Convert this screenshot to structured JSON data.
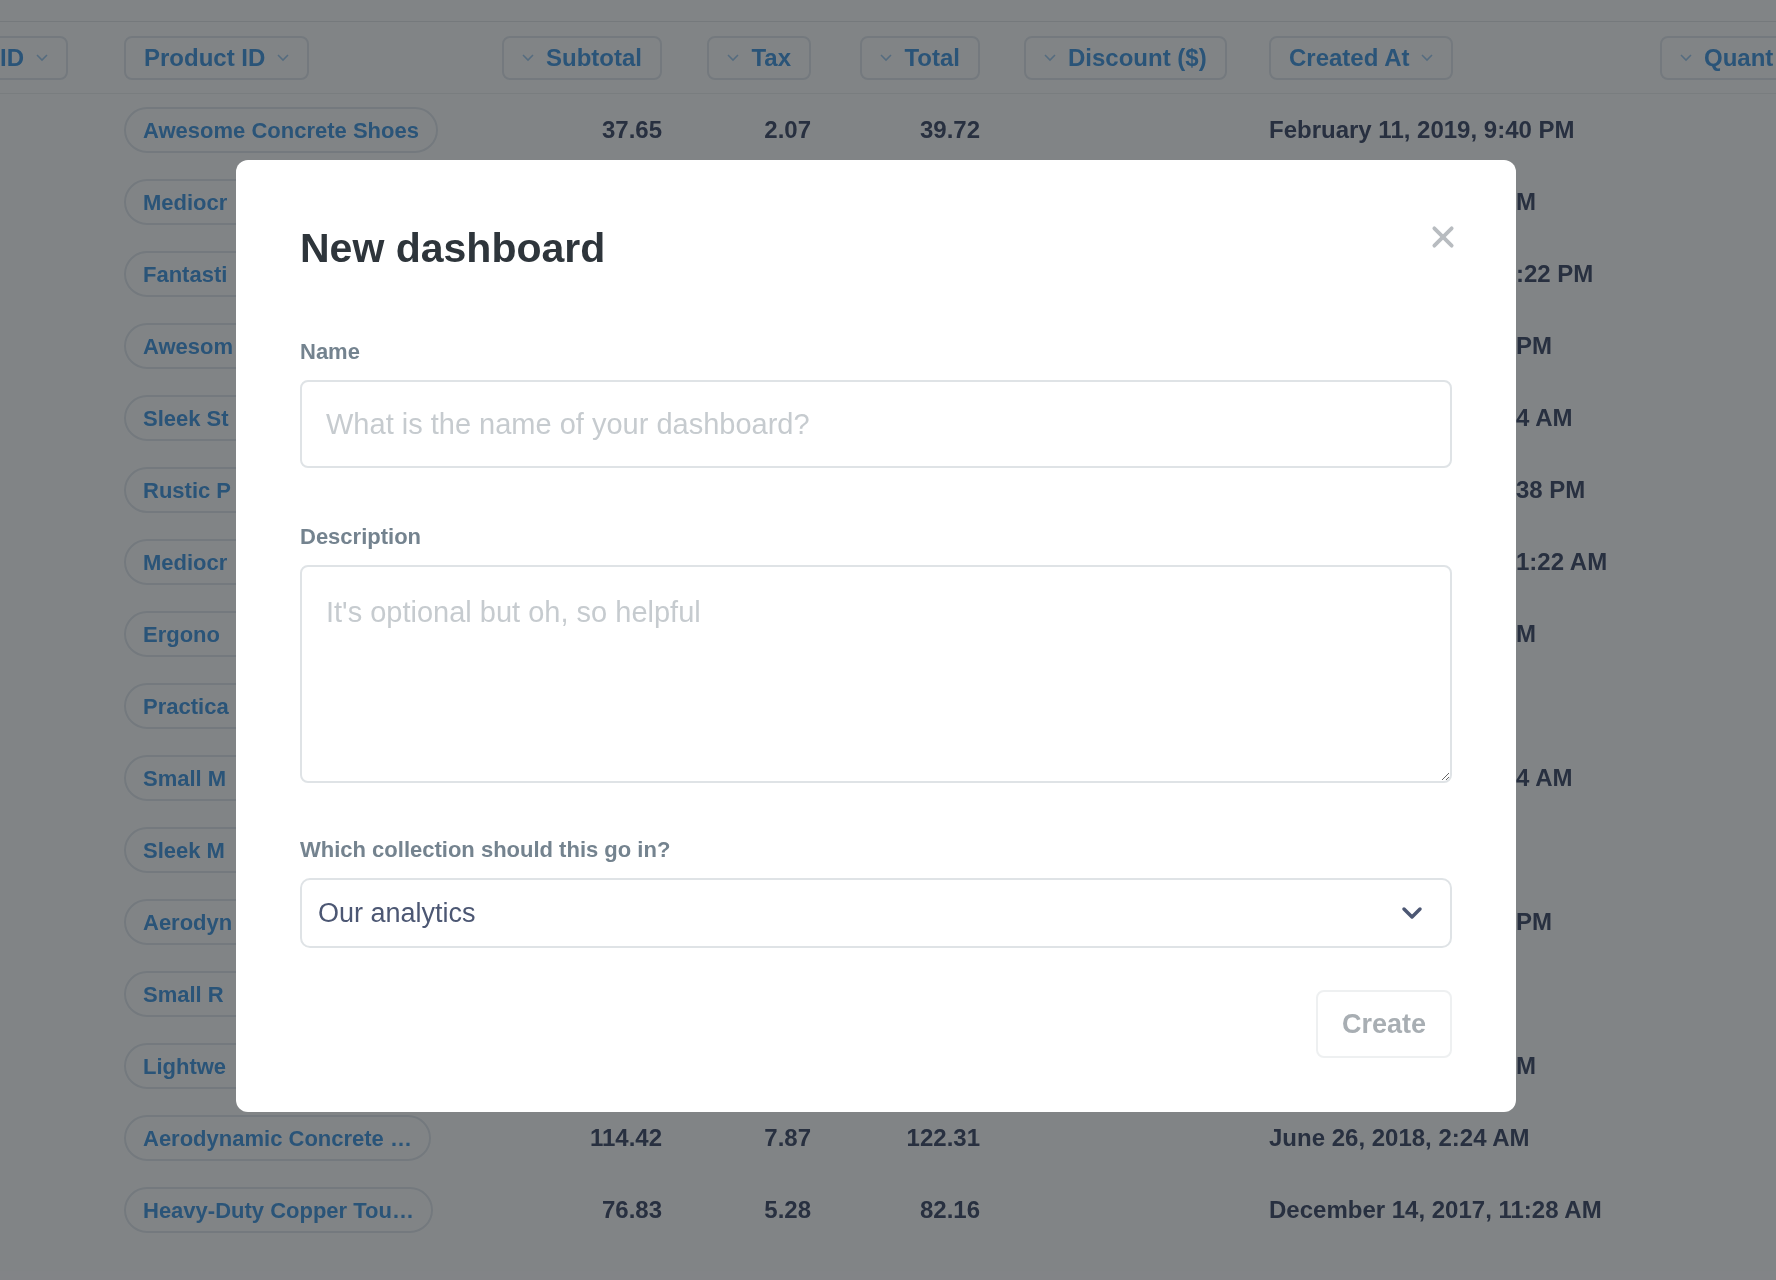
{
  "table": {
    "columns": [
      {
        "label": "ID",
        "kind": "text"
      },
      {
        "label": "Product ID",
        "kind": "text"
      },
      {
        "label": "Subtotal",
        "kind": "number"
      },
      {
        "label": "Tax",
        "kind": "number"
      },
      {
        "label": "Total",
        "kind": "number"
      },
      {
        "label": "Discount ($)",
        "kind": "number"
      },
      {
        "label": "Created At",
        "kind": "text"
      },
      {
        "label": "Quant",
        "kind": "number"
      }
    ],
    "rows": [
      {
        "covered": false,
        "product": "Awesome Concrete Shoes",
        "subtotal": "37.65",
        "tax": "2.07",
        "total": "39.72",
        "created_at": "February 11, 2019, 9:40 PM"
      },
      {
        "covered": true,
        "product": "Mediocr",
        "created_at": "M"
      },
      {
        "covered": true,
        "product": "Fantasti",
        "created_at": ":22 PM"
      },
      {
        "covered": true,
        "product": "Awesom",
        "created_at": "PM"
      },
      {
        "covered": true,
        "product": "Sleek St",
        "created_at": "4 AM"
      },
      {
        "covered": true,
        "product": "Rustic P",
        "created_at": "38 PM"
      },
      {
        "covered": true,
        "product": "Mediocr",
        "created_at": "1:22 AM"
      },
      {
        "covered": true,
        "product": "Ergono",
        "created_at": "M"
      },
      {
        "covered": true,
        "product": "Practica"
      },
      {
        "covered": true,
        "product": "Small M",
        "created_at": "4 AM"
      },
      {
        "covered": true,
        "product": "Sleek M"
      },
      {
        "covered": true,
        "product": "Aerodyn",
        "created_at": "PM"
      },
      {
        "covered": true,
        "product": "Small R"
      },
      {
        "covered": true,
        "product": "Lightwe",
        "created_at": "M"
      },
      {
        "covered": false,
        "product": "Aerodynamic Concrete …",
        "subtotal": "114.42",
        "tax": "7.87",
        "total": "122.31",
        "created_at": "June 26, 2018, 2:24 AM"
      },
      {
        "covered": false,
        "product": "Heavy-Duty Copper Tou…",
        "subtotal": "76.83",
        "tax": "5.28",
        "total": "82.16",
        "created_at": "December 14, 2017, 11:28 AM"
      }
    ]
  },
  "modal": {
    "title": "New dashboard",
    "name_field": {
      "label": "Name",
      "placeholder": "What is the name of your dashboard?"
    },
    "description_field": {
      "label": "Description",
      "placeholder": "It's optional but oh, so helpful"
    },
    "collection_field": {
      "label": "Which collection should this go in?",
      "value": "Our analytics"
    },
    "create_button": {
      "label": "Create",
      "disabled": true
    }
  }
}
